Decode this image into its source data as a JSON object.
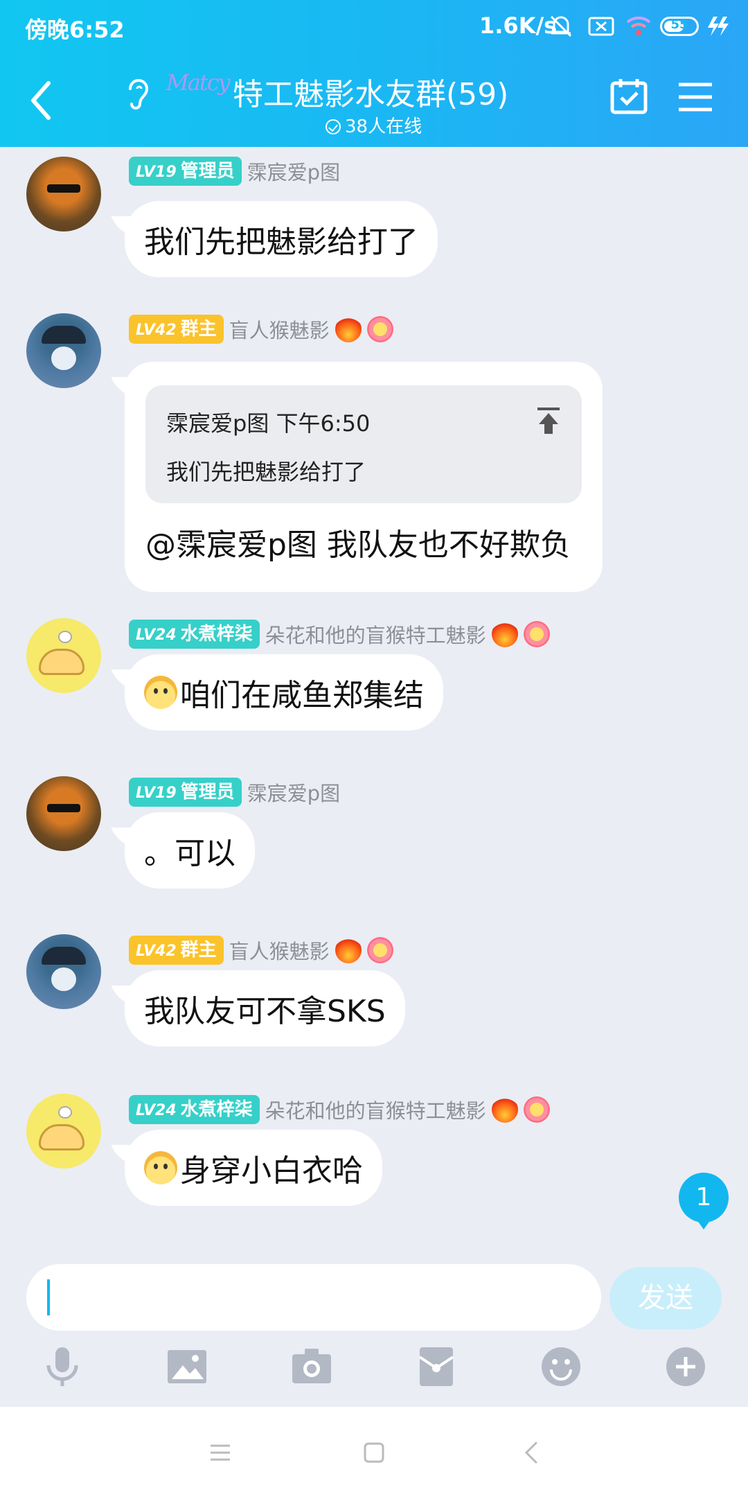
{
  "status": {
    "time": "傍晚6:52",
    "speed": "1.6K/s",
    "battery": "55"
  },
  "header": {
    "title": "特工魅影水友群(59)",
    "logo_text": "Matcy",
    "online": "38人在线"
  },
  "messages": [
    {
      "level": "LV19",
      "role": "管理员",
      "level_color": "teal",
      "name": "霂宸爱p图",
      "text": "我们先把魅影给打了"
    },
    {
      "level": "LV42",
      "role": "群主",
      "level_color": "gold",
      "name": "盲人猴魅影",
      "quote": {
        "author": "霂宸爱p图",
        "time": "下午6:50",
        "text": "我们先把魅影给打了"
      },
      "text": "@霂宸爱p图 我队友也不好欺负"
    },
    {
      "level": "LV24",
      "role": "水煮梓柒",
      "level_color": "teal",
      "name": "朵花和他的盲猴特工魅影",
      "text": "咱们在咸鱼郑集结"
    },
    {
      "level": "LV19",
      "role": "管理员",
      "level_color": "teal",
      "name": "霂宸爱p图",
      "text": "。可以"
    },
    {
      "level": "LV42",
      "role": "群主",
      "level_color": "gold",
      "name": "盲人猴魅影",
      "text": "我队友可不拿SKS"
    },
    {
      "level": "LV24",
      "role": "水煮梓柒",
      "level_color": "teal",
      "name": "朵花和他的盲猴特工魅影",
      "text": "身穿小白衣哈"
    }
  ],
  "unread_count": "1",
  "input": {
    "value": "",
    "send_label": "发送"
  },
  "tools": [
    "mic-icon",
    "image-icon",
    "camera-icon",
    "red-packet-icon",
    "emoji-icon",
    "plus-icon"
  ],
  "colors": {
    "header": "#1ab8f3",
    "teal": "#36d0c9",
    "gold": "#fbc32b",
    "background": "#eaedf4"
  }
}
